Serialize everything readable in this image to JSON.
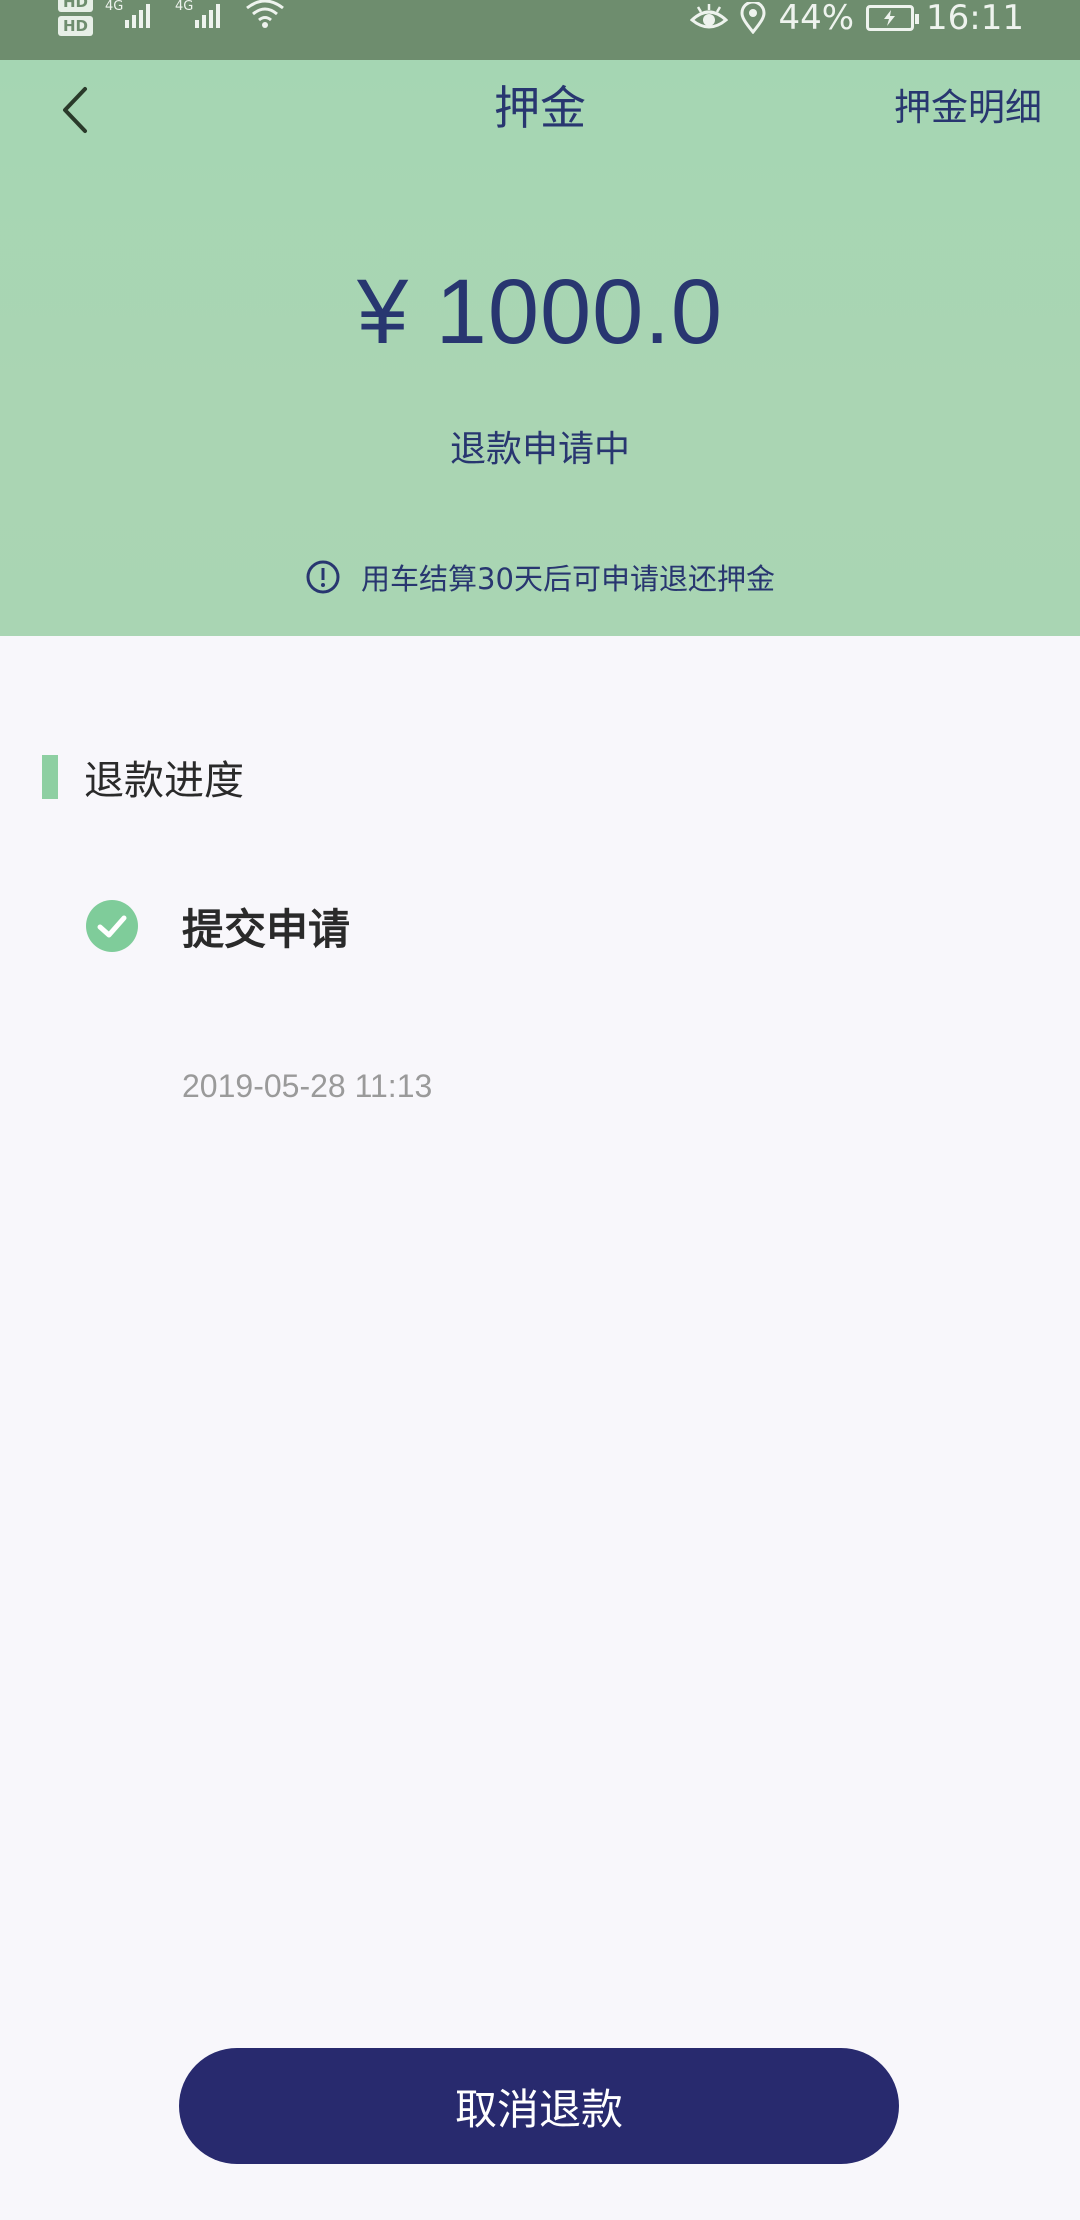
{
  "status_bar": {
    "hd1": "HD",
    "hd2": "HD",
    "net1": "4G",
    "net2": "4G",
    "battery": "44%",
    "time": "16:11"
  },
  "header": {
    "title": "押金",
    "detail_link": "押金明细",
    "amount": "¥ 1000.0",
    "status": "退款申请中",
    "notice": "用车结算30天后可申请退还押金"
  },
  "progress": {
    "title": "退款进度",
    "steps": [
      {
        "label": "提交申请",
        "time": "2019-05-28 11:13"
      }
    ]
  },
  "actions": {
    "cancel_label": "取消退款"
  },
  "colors": {
    "header_bg": "#a8d5b3",
    "accent_green": "#8ecfa2",
    "navy": "#283670",
    "button_bg": "#282a6e"
  }
}
